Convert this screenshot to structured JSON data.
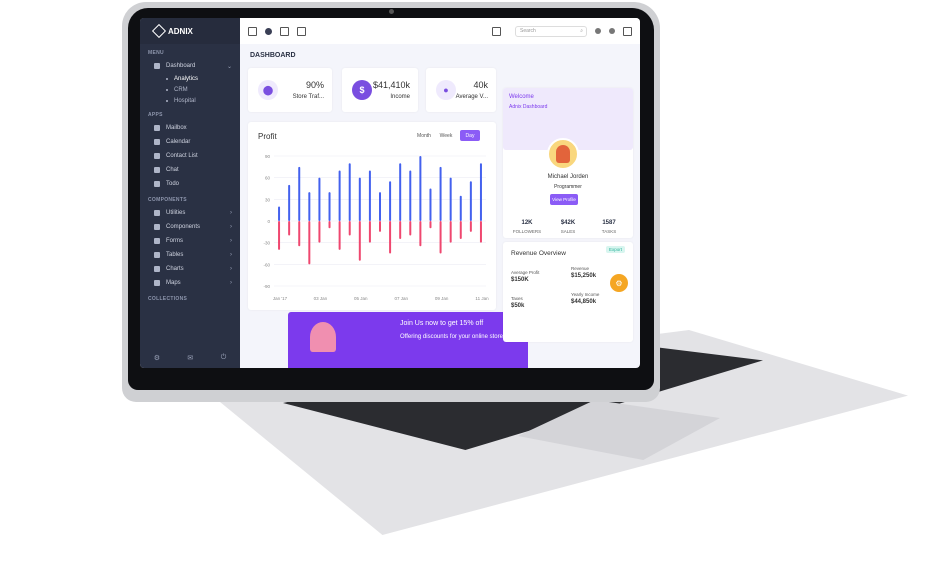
{
  "app": {
    "brand": "ADNIX"
  },
  "sidebar": {
    "section_menu": "MENU",
    "dashboard": "Dashboard",
    "dashboard_sub": [
      "Analytics",
      "CRM",
      "Hospital"
    ],
    "section_apps": "APPS",
    "apps": [
      "Mailbox",
      "Calendar",
      "Contact List",
      "Chat",
      "Todo"
    ],
    "section_components": "COMPONENTS",
    "components": [
      "Utilities",
      "Components",
      "Forms",
      "Tables",
      "Charts",
      "Maps"
    ],
    "section_collections": "COLLECTIONS"
  },
  "topbar": {
    "search_placeholder": "Search"
  },
  "page_title": "DASHBOARD",
  "stats": [
    {
      "value": "90%",
      "label": "Store Traf...",
      "icon": "network-icon"
    },
    {
      "value": "$41,410k",
      "label": "Income",
      "icon": "dollar-icon"
    },
    {
      "value": "40k",
      "label": "Average V...",
      "icon": "user-icon"
    }
  ],
  "profit": {
    "title": "Profit",
    "toggles": [
      "Month",
      "Week",
      "Day"
    ],
    "active_toggle": "Day"
  },
  "chart_data": {
    "type": "bar",
    "title": "Profit",
    "x_tick_labels": [
      "Jan '17",
      "03 Jan",
      "05 Jan",
      "07 Jan",
      "09 Jan",
      "11 Jan"
    ],
    "y_tick_labels": [
      "90",
      "60",
      "30",
      "0",
      "-30",
      "-60",
      "-90"
    ],
    "ylim": [
      -90,
      90
    ],
    "series": [
      {
        "color": "#4361ee",
        "values": [
          20,
          50,
          75,
          40,
          60,
          40,
          70,
          80,
          60,
          70,
          40,
          55,
          80,
          70,
          90,
          45,
          75,
          60,
          35,
          55,
          80
        ]
      },
      {
        "color": "#ef476f",
        "values": [
          -40,
          -20,
          -35,
          -60,
          -30,
          -10,
          -40,
          -20,
          -55,
          -30,
          -15,
          -45,
          -25,
          -20,
          -35,
          -10,
          -45,
          -30,
          -25,
          -15,
          -30
        ]
      }
    ]
  },
  "banner": {
    "title": "Join Us now to get 15% off",
    "subtitle": "Offering discounts for your online store can be a"
  },
  "welcome": {
    "line1": "Welcome",
    "line2": "Adnix Dashboard"
  },
  "profile": {
    "name": "Michael Jorden",
    "role": "Programmer",
    "button": "View Profile",
    "kpis": [
      {
        "value": "12K",
        "label": "FOLLOWERS"
      },
      {
        "value": "$42K",
        "label": "SALES"
      },
      {
        "value": "1587",
        "label": "TASKS"
      }
    ]
  },
  "revenue": {
    "title": "Revenue Overview",
    "tag": "Export",
    "items": [
      {
        "label": "Average Profit",
        "value": "$150K"
      },
      {
        "label": "Revenue",
        "value": "$15,250k"
      },
      {
        "label": "Taxes",
        "value": "$50k"
      },
      {
        "label": "Yearly Income",
        "value": "$44,850k"
      }
    ]
  }
}
